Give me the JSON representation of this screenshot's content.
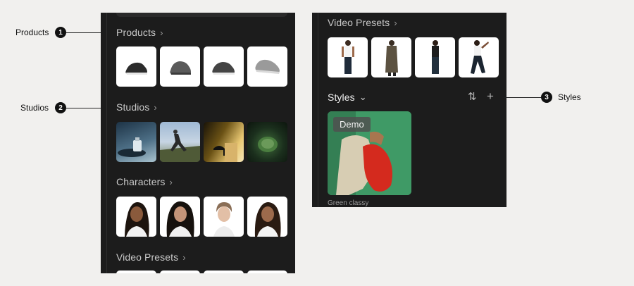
{
  "callouts": [
    {
      "label": "Products",
      "number": "1"
    },
    {
      "label": "Studios",
      "number": "2"
    },
    {
      "label": "Styles",
      "number": "3"
    }
  ],
  "left_panel": {
    "sections": [
      {
        "title": "Products",
        "thumbs": [
          "sneaker-black",
          "sneaker-gray-dark",
          "sneaker-charcoal",
          "sneaker-light-gray"
        ]
      },
      {
        "title": "Studios",
        "thumbs": [
          "perfume-on-rocks",
          "man-walking-on-cliff",
          "heel-on-pedestal",
          "forest-moss-scene"
        ]
      },
      {
        "title": "Characters",
        "thumbs": [
          "woman-long-dark-hair",
          "woman-dark-hair-center-part",
          "woman-short-hair",
          "woman-long-hair-smile"
        ]
      },
      {
        "title": "Video Presets",
        "thumbs": [
          "partial",
          "partial",
          "partial",
          "partial"
        ]
      }
    ]
  },
  "right_panel": {
    "video_presets_title": "Video Presets",
    "video_thumbs": [
      "model-white-tank",
      "model-long-coat",
      "model-dark-outfit",
      "model-dancing-pose"
    ],
    "styles_title": "Styles",
    "sort_icon": "sort-icon",
    "add_icon": "plus-icon",
    "style_card": {
      "badge": "Demo",
      "caption": "Green classy"
    }
  },
  "colors": {
    "panel": "#1c1c1c",
    "background": "#f1f0ee",
    "callout": "#111111"
  }
}
